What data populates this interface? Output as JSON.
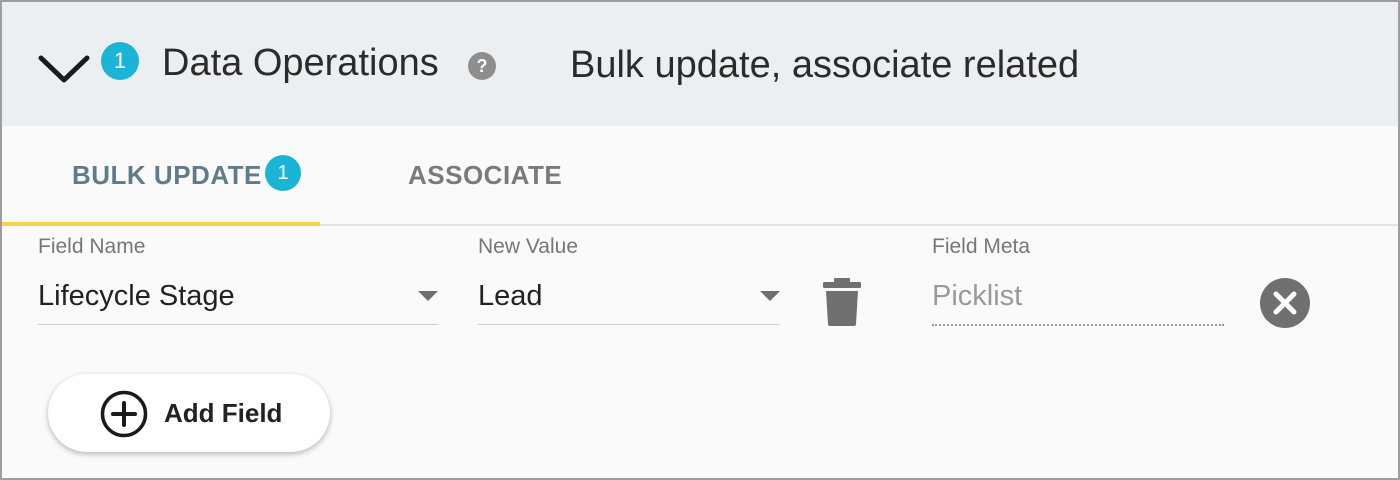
{
  "colors": {
    "badge": "#1ab4d6",
    "tab_active_text": "#5e7c8c",
    "tab_inactive_text": "#7a7a7a",
    "tab_underline": "#f5d44a",
    "header_bg": "#eceff1"
  },
  "header": {
    "toggle_icon": "chevron-down-icon",
    "badge_count": "1",
    "title": "Data Operations",
    "help_icon": "help-icon",
    "help_symbol": "?",
    "description": "Bulk update, associate related"
  },
  "tabs": [
    {
      "label": "BULK UPDATE",
      "badge": "1",
      "active": true
    },
    {
      "label": "ASSOCIATE",
      "active": false
    }
  ],
  "bulk_update": {
    "field_name": {
      "label": "Field Name",
      "value": "Lifecycle Stage"
    },
    "new_value": {
      "label": "New Value",
      "value": "Lead"
    },
    "delete_icon": "trash-icon",
    "field_meta": {
      "label": "Field Meta",
      "value": "Picklist"
    },
    "remove_icon": "close-icon",
    "add_button": {
      "label": "Add Field",
      "icon": "plus-circle-icon"
    }
  }
}
